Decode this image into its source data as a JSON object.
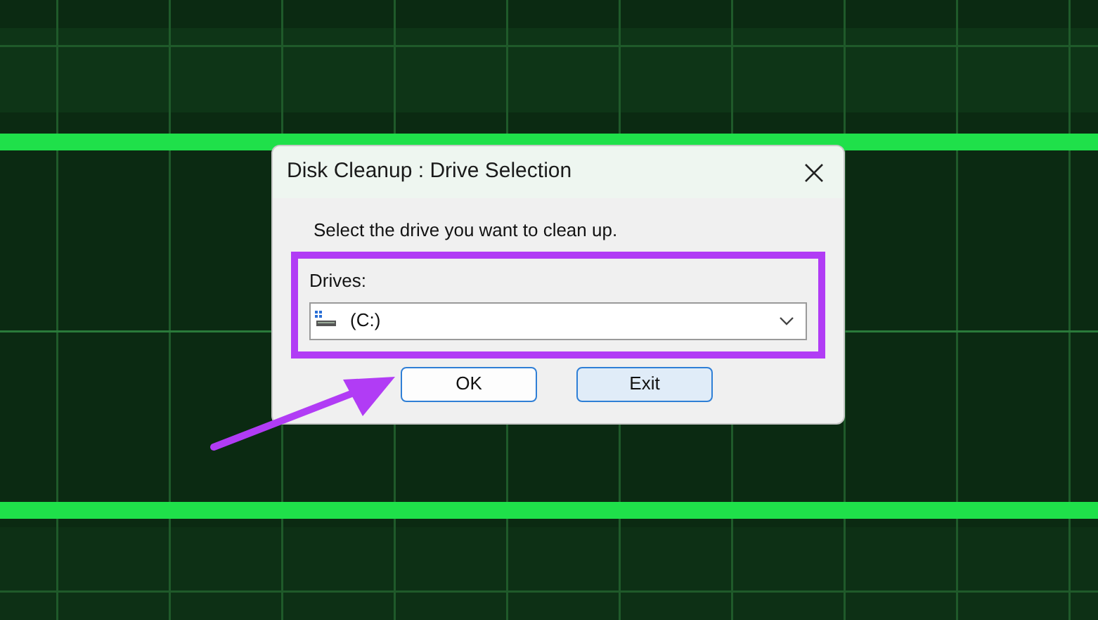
{
  "window": {
    "title": "Disk Cleanup : Drive Selection"
  },
  "instruction": "Select the drive you want to clean up.",
  "drives": {
    "label": "Drives:",
    "value": "(C:)",
    "highlighted": true
  },
  "buttons": [
    {
      "label": "OK",
      "hovered": false
    },
    {
      "label": "Exit",
      "hovered": true
    }
  ],
  "annotation_arrow": true
}
